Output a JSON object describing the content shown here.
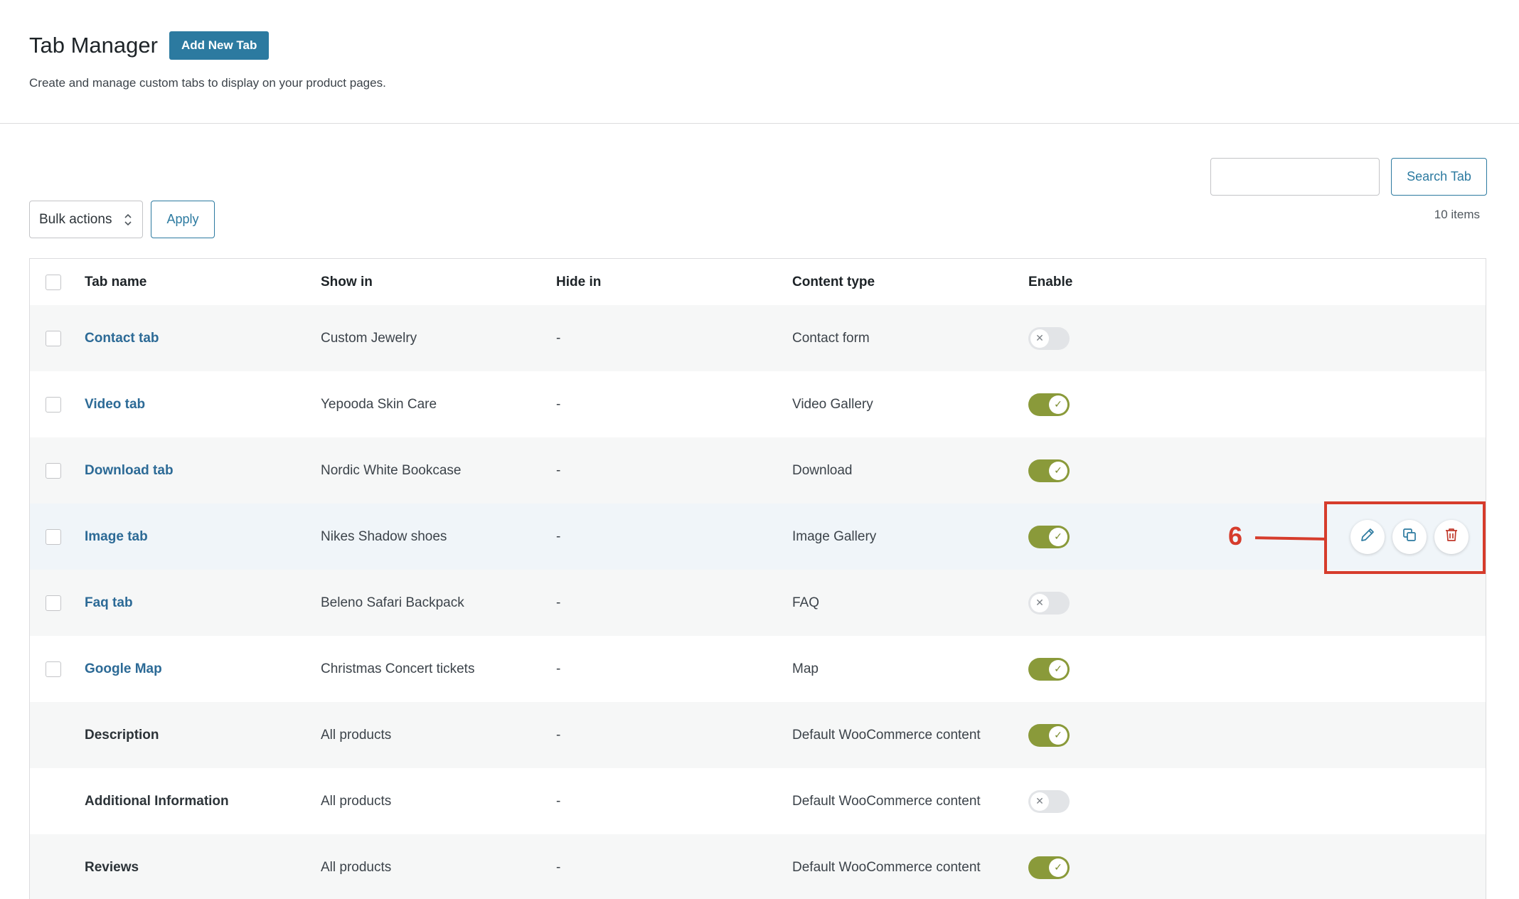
{
  "header": {
    "title": "Tab Manager",
    "add_button": "Add New Tab",
    "subtitle": "Create and manage custom tabs to display on your product pages."
  },
  "search": {
    "value": "",
    "button": "Search Tab"
  },
  "items_count": "10 items",
  "bulk": {
    "selected": "Bulk actions",
    "apply": "Apply"
  },
  "columns": {
    "name": "Tab name",
    "show": "Show in",
    "hide": "Hide in",
    "type": "Content type",
    "enable": "Enable"
  },
  "rows": [
    {
      "name": "Contact tab",
      "show": "Custom Jewelry",
      "hide": "-",
      "type": "Contact form",
      "enabled": false
    },
    {
      "name": "Video tab",
      "show": "Yepooda Skin Care",
      "hide": "-",
      "type": "Video Gallery",
      "enabled": true
    },
    {
      "name": "Download tab",
      "show": "Nordic White Bookcase",
      "hide": "-",
      "type": "Download",
      "enabled": true
    },
    {
      "name": "Image tab",
      "show": "Nikes Shadow shoes",
      "hide": "-",
      "type": "Image Gallery",
      "enabled": true
    },
    {
      "name": "Faq tab",
      "show": "Beleno Safari Backpack",
      "hide": "-",
      "type": "FAQ",
      "enabled": false
    },
    {
      "name": "Google Map",
      "show": "Christmas Concert tickets",
      "hide": "-",
      "type": "Map",
      "enabled": true
    },
    {
      "name": "Description",
      "show": "All products",
      "hide": "-",
      "type": "Default WooCommerce content",
      "enabled": true
    },
    {
      "name": "Additional Information",
      "show": "All products",
      "hide": "-",
      "type": "Default WooCommerce content",
      "enabled": false
    },
    {
      "name": "Reviews",
      "show": "All products",
      "hide": "-",
      "type": "Default WooCommerce content",
      "enabled": true
    }
  ],
  "row_actions": [
    "pencil-icon",
    "duplicate-icon",
    "trash-icon"
  ],
  "callout": {
    "number": "6",
    "color": "#d63c2c"
  },
  "colors": {
    "primary": "#2c7aa0",
    "toggle_on": "#8a9a3a",
    "toggle_off": "#e2e4e7"
  }
}
